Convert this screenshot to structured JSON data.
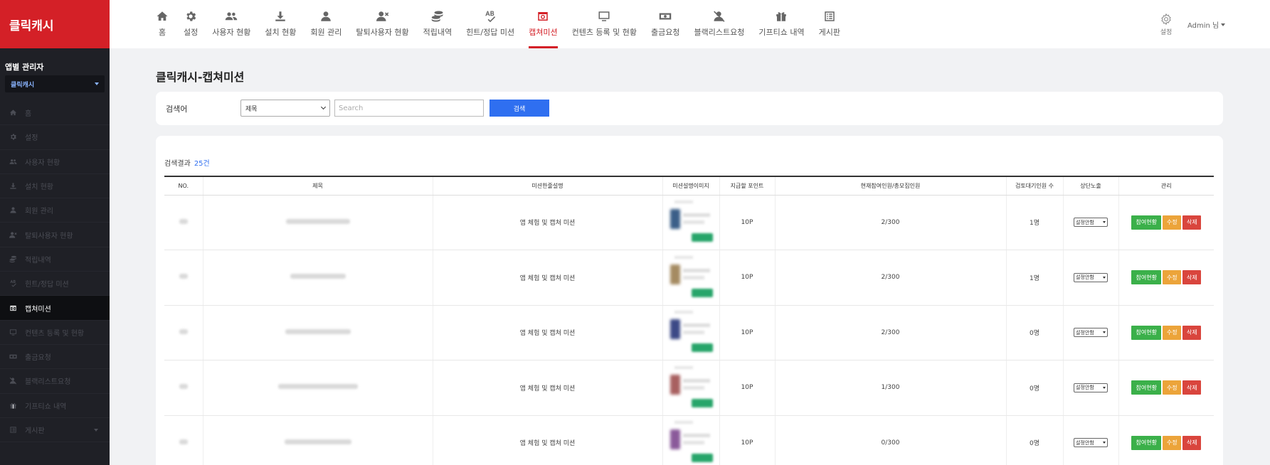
{
  "brand": "클릭캐시",
  "app_admin": {
    "label": "앱별 관리자",
    "selected": "클릭캐시"
  },
  "sidebar": [
    {
      "label": "홈",
      "icon": "home-icon"
    },
    {
      "label": "설정",
      "icon": "gear-icon"
    },
    {
      "label": "사용자 현황",
      "icon": "users-icon"
    },
    {
      "label": "설치 현황",
      "icon": "download-icon"
    },
    {
      "label": "회원 관리",
      "icon": "user-icon"
    },
    {
      "label": "탈퇴사용자 현황",
      "icon": "user-remove-icon"
    },
    {
      "label": "적립내역",
      "icon": "coins-icon"
    },
    {
      "label": "힌트/정답 미션",
      "icon": "spellcheck-icon"
    },
    {
      "label": "캡쳐미션",
      "icon": "capture-icon",
      "active": true
    },
    {
      "label": "컨텐츠 등록 및 현황",
      "icon": "monitor-icon"
    },
    {
      "label": "출금요청",
      "icon": "money-icon"
    },
    {
      "label": "블랙리스트요청",
      "icon": "user-block-icon"
    },
    {
      "label": "기프티쇼 내역",
      "icon": "gift-icon"
    },
    {
      "label": "게시판",
      "icon": "board-icon",
      "has_chevron": true
    }
  ],
  "topnav": [
    {
      "label": "홈",
      "icon": "home-icon"
    },
    {
      "label": "설정",
      "icon": "gear-icon"
    },
    {
      "label": "사용자 현황",
      "icon": "users-icon"
    },
    {
      "label": "설치 현황",
      "icon": "download-icon"
    },
    {
      "label": "회원 관리",
      "icon": "user-icon"
    },
    {
      "label": "탈퇴사용자 현황",
      "icon": "user-remove-icon"
    },
    {
      "label": "적립내역",
      "icon": "coins-icon"
    },
    {
      "label": "힌트/정답 미션",
      "icon": "spellcheck-icon"
    },
    {
      "label": "캡쳐미션",
      "icon": "capture-icon",
      "active": true
    },
    {
      "label": "컨텐츠 등록 및 현황",
      "icon": "monitor-icon"
    },
    {
      "label": "출금요청",
      "icon": "money-icon"
    },
    {
      "label": "블랙리스트요청",
      "icon": "user-block-icon"
    },
    {
      "label": "기프티쇼 내역",
      "icon": "gift-icon"
    },
    {
      "label": "게시판",
      "icon": "board-icon"
    }
  ],
  "top_right": {
    "settings_label": "설정",
    "admin_label": "Admin 님"
  },
  "page_title": "클릭캐시-캡쳐미션",
  "search": {
    "label": "검색어",
    "select_value": "제목",
    "placeholder": "Search",
    "button": "검색"
  },
  "results": {
    "label": "검색결과",
    "count": "25건"
  },
  "table": {
    "headers": [
      "NO.",
      "제목",
      "미션한줄설명",
      "미션설명이미지",
      "지급할 포인트",
      "현재참여인원/총모집인원",
      "검토대기인원 수",
      "상단노출",
      "관리"
    ],
    "rows": [
      {
        "desc": "앱 체험 및 캡쳐 미션",
        "points": "10P",
        "participants": "2/300",
        "pending": "1명",
        "top": "설정안함",
        "thumb_color": "#3b5f88"
      },
      {
        "desc": "앱 체험 및 캡쳐 미션",
        "points": "10P",
        "participants": "2/300",
        "pending": "1명",
        "top": "설정안함",
        "thumb_color": "#a58b62"
      },
      {
        "desc": "앱 체험 및 캡쳐 미션",
        "points": "10P",
        "participants": "2/300",
        "pending": "0명",
        "top": "설정안함",
        "thumb_color": "#3c4a86"
      },
      {
        "desc": "앱 체험 및 캡쳐 미션",
        "points": "10P",
        "participants": "1/300",
        "pending": "0명",
        "top": "설정안함",
        "thumb_color": "#a86060"
      },
      {
        "desc": "앱 체험 및 캡쳐 미션",
        "points": "10P",
        "participants": "0/300",
        "pending": "0명",
        "top": "설정안함",
        "thumb_color": "#8a5a9a"
      }
    ],
    "actions": {
      "participation": "참여현황",
      "edit": "수정",
      "delete": "삭제"
    }
  },
  "colors": {
    "brand_red": "#d42027",
    "primary_blue": "#2f6ff0",
    "green": "#3bb04a",
    "orange": "#eca43a",
    "red": "#d9453d"
  }
}
